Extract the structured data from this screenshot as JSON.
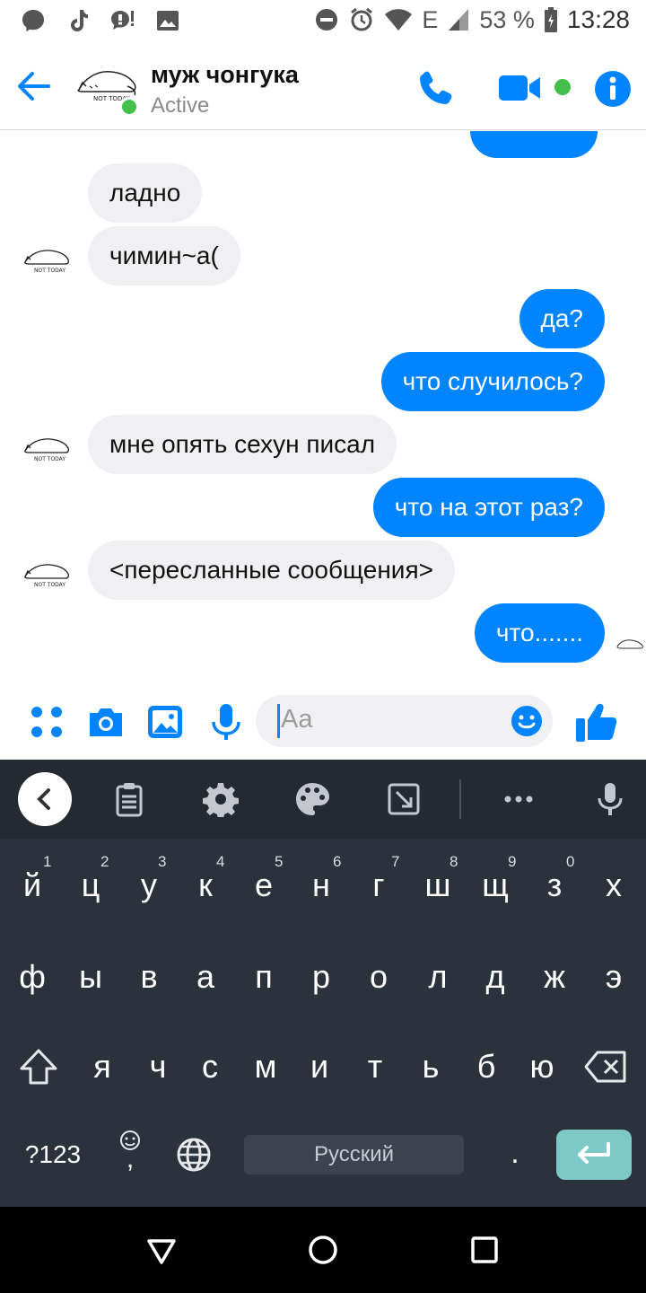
{
  "status_bar": {
    "network": "E",
    "battery": "53 %",
    "time": "13:28"
  },
  "header": {
    "contact_name": "муж чонгука",
    "contact_status": "Active"
  },
  "messages": [
    {
      "side": "in",
      "text": "ладно"
    },
    {
      "side": "in",
      "text": "чимин~а("
    },
    {
      "side": "out",
      "text": "да?"
    },
    {
      "side": "out",
      "text": "что случилось?"
    },
    {
      "side": "in",
      "text": "мне опять сехун писал"
    },
    {
      "side": "out",
      "text": "что на этот раз?"
    },
    {
      "side": "in",
      "text": "<пересланные сообщения>"
    },
    {
      "side": "out",
      "text": "что......."
    }
  ],
  "composer": {
    "placeholder": "Aa"
  },
  "keyboard": {
    "row1": [
      "й",
      "ц",
      "у",
      "к",
      "е",
      "н",
      "г",
      "ш",
      "щ",
      "з",
      "х"
    ],
    "row1_hints": [
      "1",
      "2",
      "3",
      "4",
      "5",
      "6",
      "7",
      "8",
      "9",
      "0"
    ],
    "row2": [
      "ф",
      "ы",
      "в",
      "а",
      "п",
      "р",
      "о",
      "л",
      "д",
      "ж",
      "э"
    ],
    "row3": [
      "я",
      "ч",
      "с",
      "м",
      "и",
      "т",
      "ь",
      "б",
      "ю"
    ],
    "symbols_key": "?123",
    "comma_key": ",",
    "space_label": "Русский",
    "period_key": "."
  },
  "colors": {
    "accent": "#0084ff",
    "online": "#44c04a",
    "incoming_bubble": "#f0f0f2",
    "keyboard_bg": "#2b323c",
    "enter_key": "#7fc8c8"
  }
}
